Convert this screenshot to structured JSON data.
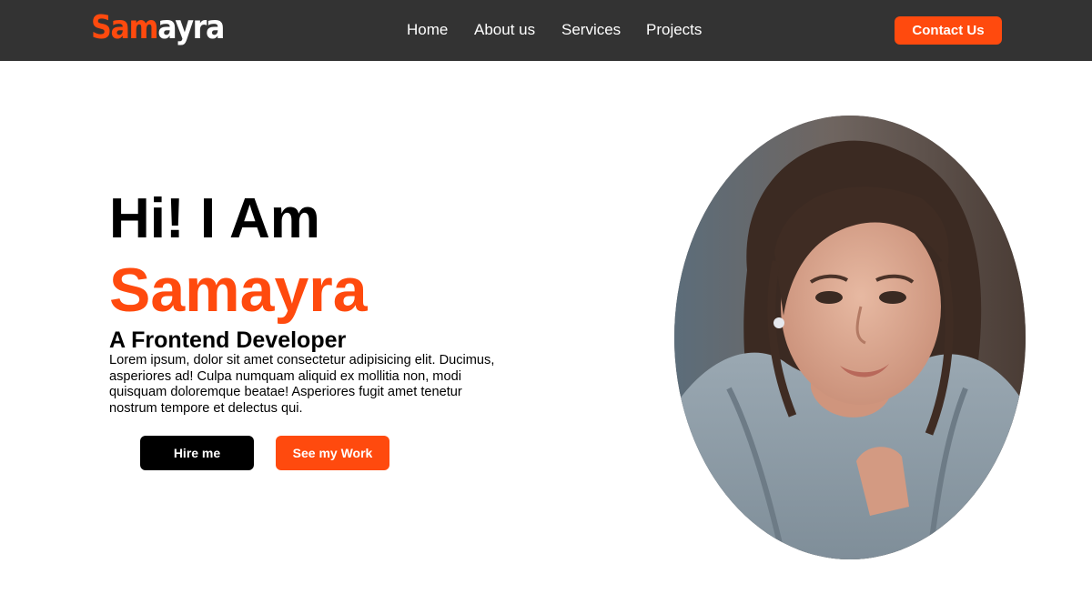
{
  "brand": {
    "part1": "Sam",
    "part2": "ayra"
  },
  "nav": {
    "links": [
      "Home",
      "About us",
      "Services",
      "Projects"
    ],
    "contact_label": "Contact Us"
  },
  "hero": {
    "greeting": "Hi! I Am",
    "name": "Samayra",
    "role": "A Frontend Developer",
    "bio": "Lorem ipsum, dolor sit amet consectetur adipisicing elit. Ducimus, asperiores ad! Culpa numquam aliquid ex mollitia non, modi quisquam doloremque beatae! Asperiores fugit amet tenetur nostrum tempore et delectus qui.",
    "hire_label": "Hire me",
    "work_label": "See my Work"
  },
  "colors": {
    "accent": "#ff4a0e",
    "navbar_bg": "#333333",
    "text": "#000000"
  }
}
